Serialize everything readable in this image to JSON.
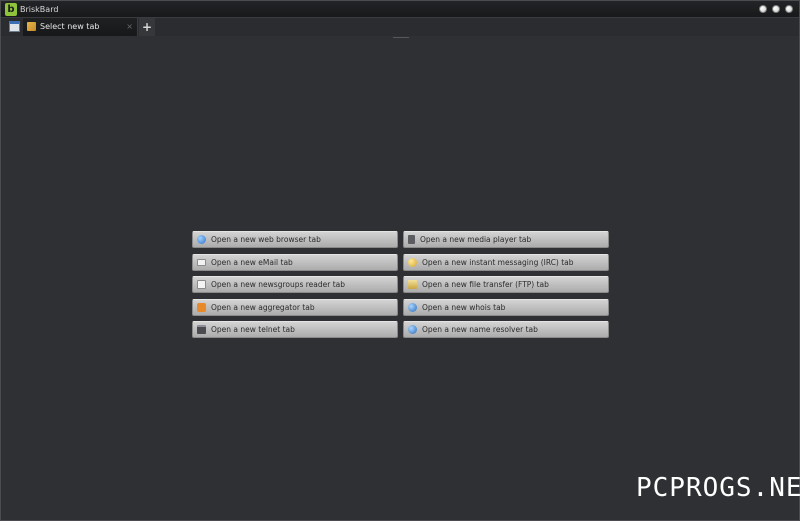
{
  "window": {
    "title": "BriskBard",
    "logo_letter": "b",
    "colors": {
      "accent": "#8fc43a",
      "background": "#2e3034",
      "button": "#c4c4c4"
    }
  },
  "tabs": [
    {
      "label": "Select new tab",
      "icon": "new-tab-page-icon",
      "close_glyph": "×"
    }
  ],
  "new_tab_label": "+",
  "actions": {
    "left": [
      {
        "label": "Open a new web browser tab",
        "icon": "globe-icon"
      },
      {
        "label": "Open a new eMail tab",
        "icon": "mail-icon"
      },
      {
        "label": "Open a new newsgroups reader tab",
        "icon": "newsgroup-icon"
      },
      {
        "label": "Open a new aggregator tab",
        "icon": "rss-icon"
      },
      {
        "label": "Open a new telnet tab",
        "icon": "terminal-icon"
      }
    ],
    "right": [
      {
        "label": "Open a new media player tab",
        "icon": "media-player-icon"
      },
      {
        "label": "Open a new instant messaging (IRC) tab",
        "icon": "chat-icon"
      },
      {
        "label": "Open a new file transfer (FTP) tab",
        "icon": "ftp-icon"
      },
      {
        "label": "Open a new whois tab",
        "icon": "whois-globe-icon"
      },
      {
        "label": "Open a new name resolver tab",
        "icon": "dns-globe-icon"
      }
    ]
  },
  "watermark": "PCPROGS.NET"
}
